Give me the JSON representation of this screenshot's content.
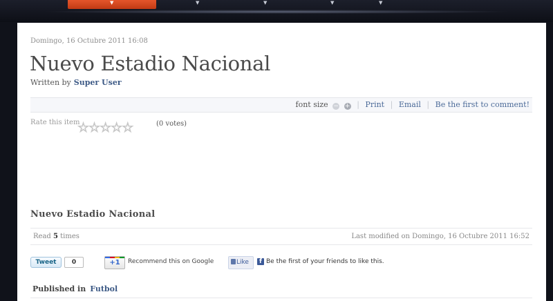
{
  "nav": {
    "arrow": "▼",
    "items": [
      {
        "name": "nav-item-active"
      },
      {
        "name": "nav-item-2"
      },
      {
        "name": "nav-item-3"
      },
      {
        "name": "nav-item-4"
      },
      {
        "name": "nav-item-5"
      }
    ],
    "active_color": "#d8471e"
  },
  "article": {
    "date": "Domingo, 16 Octubre 2011 16:08",
    "title": "Nuevo Estadio Nacional",
    "written_by_label": "Written by",
    "author": "Super User",
    "subtitle": "Nuevo Estadio Nacional"
  },
  "toolbar": {
    "font_size_label": "font size",
    "decrease_icon": "minus-icon",
    "increase_icon": "plus-icon",
    "print_label": "Print",
    "email_label": "Email",
    "comment_label": "Be the first to comment!",
    "minus_glyph": "−",
    "plus_glyph": "+"
  },
  "rating": {
    "label": "Rate this item",
    "star_glyph": "☆",
    "stars_total": 5,
    "votes_text": "(0 votes)"
  },
  "info": {
    "read_prefix": "Read",
    "read_count": "5",
    "read_suffix": "times",
    "last_modified": "Last modified on Domingo, 16 Octubre 2011 16:52"
  },
  "social": {
    "tweet_label": "Tweet",
    "tweet_count": "0",
    "gplus_label": "+1",
    "gplus_text": "Recommend this on Google",
    "fb_like_label": "Like",
    "fb_logo": "f",
    "fb_text": "Be the first of your friends to like this."
  },
  "published": {
    "label": "Published in",
    "category": "Futbol"
  },
  "colors": {
    "link": "#3d5a86",
    "background": "#10121a",
    "accent": "#d8471e"
  }
}
